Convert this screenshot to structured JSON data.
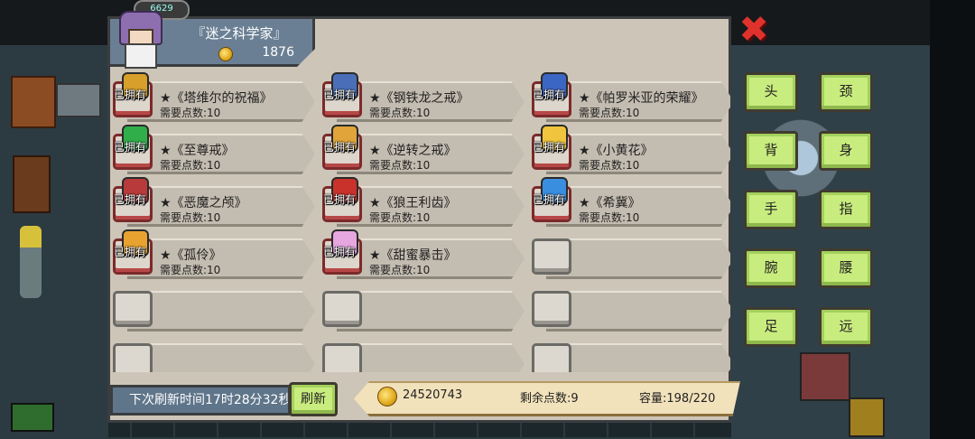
{
  "header": {
    "merchant_title": "『迷之科学家』",
    "coins": "1876",
    "badge": "6629"
  },
  "owned_label": "已拥有",
  "items": [
    {
      "name": "★《塔维尔的祝福》",
      "cost": "需要点数:10",
      "owned": true,
      "color": "#d8a02a"
    },
    {
      "name": "★《钢铁龙之戒》",
      "cost": "需要点数:10",
      "owned": true,
      "color": "#4a6fb8"
    },
    {
      "name": "★《帕罗米亚的荣耀》",
      "cost": "需要点数:10",
      "owned": true,
      "color": "#3c66c4"
    },
    {
      "name": "★《至尊戒》",
      "cost": "需要点数:10",
      "owned": true,
      "color": "#2fae4a"
    },
    {
      "name": "★《逆转之戒》",
      "cost": "需要点数:10",
      "owned": true,
      "color": "#e0a43a"
    },
    {
      "name": "★《小黄花》",
      "cost": "需要点数:10",
      "owned": true,
      "color": "#f0c43c"
    },
    {
      "name": "★《恶魔之颅》",
      "cost": "需要点数:10",
      "owned": true,
      "color": "#b83a3a"
    },
    {
      "name": "★《狼王利齿》",
      "cost": "需要点数:10",
      "owned": true,
      "color": "#c8322a"
    },
    {
      "name": "★《希冀》",
      "cost": "需要点数:10",
      "owned": true,
      "color": "#3a8ee0"
    },
    {
      "name": "★《孤伶》",
      "cost": "需要点数:10",
      "owned": true,
      "color": "#e8a230"
    },
    {
      "name": "★《甜蜜暴击》",
      "cost": "需要点数:10",
      "owned": true,
      "color": "#e6a6e0"
    }
  ],
  "categories": [
    "头",
    "颈",
    "背",
    "身",
    "手",
    "指",
    "腕",
    "腰",
    "足",
    "远"
  ],
  "footer": {
    "timer": "下次刷新时间17时28分32秒",
    "refresh_label": "刷新",
    "money": "24520743",
    "points": "剩余点数:9",
    "capacity": "容量:198/220"
  },
  "colors": {
    "accent_green": "#c9ec7e",
    "close_red": "#e0322c"
  },
  "icons": {
    "close": "close-icon",
    "coin": "coin-icon"
  }
}
